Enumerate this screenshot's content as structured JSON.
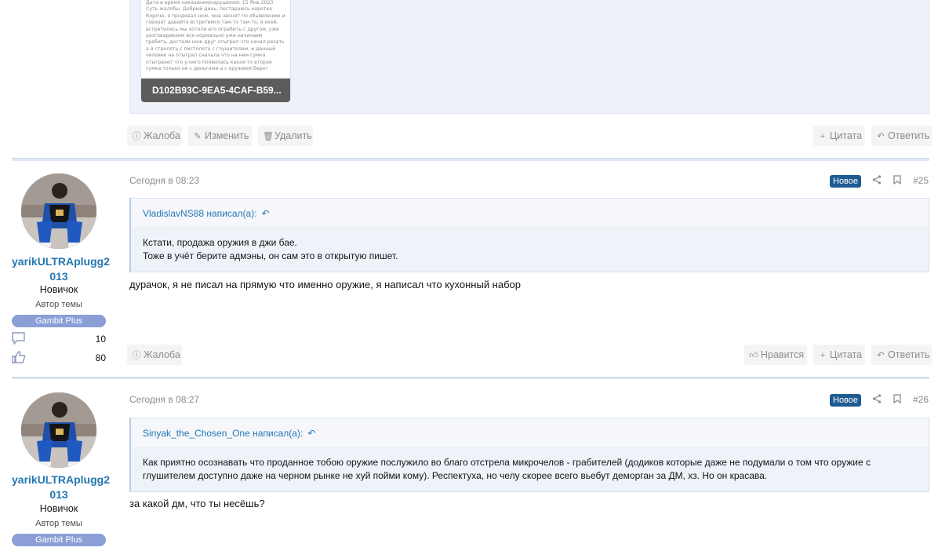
{
  "top_post": {
    "attachment": {
      "caption": "D102B93C-9EA5-4CAF-B59...",
      "preview_lines": [
        "Дата и время наказания/нарушения: 15 Янв 2023",
        "Суть жалобы: Добрый день, постараюсь коротко",
        "Короче, я продовал нож, мне звонят по обьявлению и",
        "говорят давайте встретимся там-то там-то, я окей,",
        "встретились мы хотели его ограбить с другом, уже",
        "разговариваем все нормально уже начинаем",
        "грабить, достали нож друг отыграл что начал резать",
        "а я стрелять с пистолета с глушителем, и данный",
        "человек не отыграл сначала что на нем сумка",
        "отыгрвает что у него появилась какая-то вторая",
        "сумка только не с деньгами а с оружием берет"
      ]
    },
    "actions": {
      "report": "Жалоба",
      "edit": "Изменить",
      "delete": "Удалить",
      "quote": "Цитата",
      "reply": "Ответить"
    }
  },
  "posts": [
    {
      "user": {
        "name": "yarikULTRAplugg2013",
        "name_line1": "yarikULTRAplugg2",
        "name_line2": "013",
        "title": "Новичок",
        "role": "Автор темы",
        "badge": "Gambit Plus",
        "messages": "10",
        "reactions": "80"
      },
      "date": "Сегодня в 08:23",
      "new_label": "Новое",
      "number": "#25",
      "quote": {
        "author": "VladislavNS88 написал(а):",
        "lines": [
          "Кстати, продажа оружия в джи бае.",
          "Тоже в учёт берите адмэны, он сам это в открытую пишет."
        ]
      },
      "message": "дурачок, я не писал на прямую что именно оружие, я написал что кухонный набор",
      "actions": {
        "report": "Жалоба",
        "like": "Нравится",
        "quote": "Цитата",
        "reply": "Ответить"
      }
    },
    {
      "user": {
        "name": "yarikULTRAplugg2013",
        "name_line1": "yarikULTRAplugg2",
        "name_line2": "013",
        "title": "Новичок",
        "role": "Автор темы",
        "badge": "Gambit Plus"
      },
      "date": "Сегодня в 08:27",
      "new_label": "Новое",
      "number": "#26",
      "quote": {
        "author": "Sinyak_the_Chosen_One написал(а):",
        "lines": [
          "Как приятно осознавать что проданное тобою оружие послужило во благо отстрела микрочелов - грабителей (додиков которые даже не подумали о том что оружие с",
          "глушителем доступно даже на черном рынке не хуй пойми кому). Респектуха, но челу скорее всего вьебут деморган за ДМ, хз. Но он красава."
        ]
      },
      "message": "за какой дм, что ты несёшь?"
    }
  ],
  "icons": {
    "report": "alert-circle-icon",
    "edit": "pencil-icon",
    "delete": "trash-icon",
    "quote": "plus-icon",
    "reply": "reply-icon",
    "like": "thumbs-up-icon",
    "share": "share-icon",
    "bookmark": "bookmark-icon",
    "messages": "speech-bubble-icon",
    "reactions": "thumbs-up-icon"
  },
  "colors": {
    "accent": "#2577b1",
    "new_badge": "#1f5b91",
    "user_badge": "#8b9fd6",
    "separator": "#dfe6f5"
  }
}
